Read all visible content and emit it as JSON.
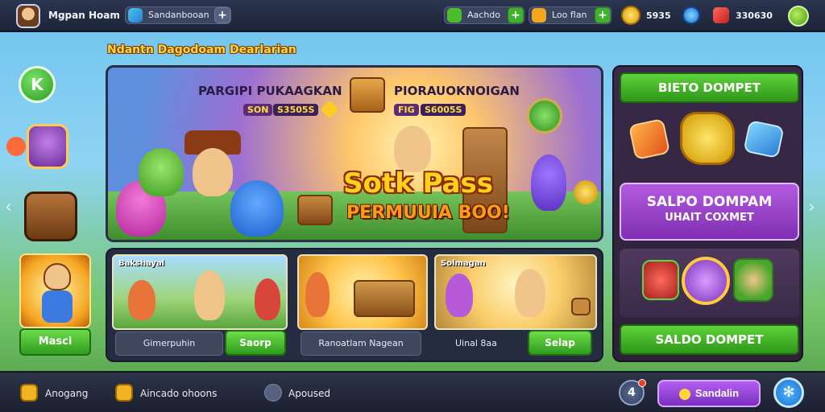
{
  "topbar": {
    "player_name": "Mgpan Hoam",
    "search_pill": "Sandanbooan",
    "currency1": "Aachdo",
    "currency2": "Loo flan",
    "coins": "5935",
    "gems": "330630"
  },
  "left": {
    "banner_title": "Ndantn Dagodoam Dearlarian",
    "home_label": "K",
    "card_button": "Masci"
  },
  "hero": {
    "heading_left": "PARGIPI PUKAAGKAN",
    "heading_right": "PIORAUOKNOIGAN",
    "sub_left": "S3505S",
    "sub_left_tag": "SON",
    "sub_right": "S6005S",
    "sub_right_tag": "FIG",
    "title": "Sotk Pass",
    "subtitle": "PERMUUIA BOO!"
  },
  "tiles": [
    {
      "label": "Bakshayal",
      "button": "Gimerpuhin",
      "button2": "Saorp"
    },
    {
      "label": "",
      "button": "Ranoatlam Nagean",
      "button2": ""
    },
    {
      "label": "Solmagan",
      "button": "Uinal 8aa",
      "button2": "Selap"
    }
  ],
  "right_panel": {
    "top_button": "BIETO DOMPET",
    "purple_line1": "SALPO DOMPAM",
    "purple_line2": "UHAIT COXMET",
    "bottom_button": "SALDO DOMPET"
  },
  "bottombar": {
    "item1": "Anogang",
    "item2": "Aincado ohoons",
    "item3": "Apoused",
    "action_button": "Sandalin"
  },
  "colors": {
    "accent_green": "#41b22e",
    "accent_purple": "#9a45d8",
    "gold": "#ffd01e"
  }
}
